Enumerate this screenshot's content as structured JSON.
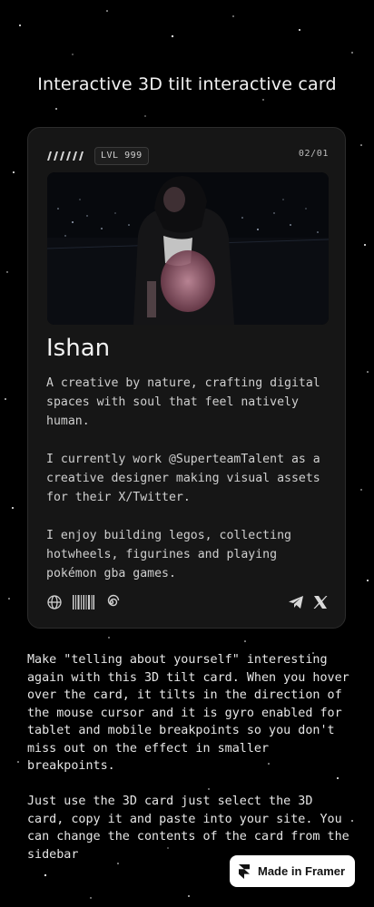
{
  "page": {
    "title": "Interactive 3D tilt interactive card",
    "background": "#000000"
  },
  "card": {
    "level_label": "LVL 999",
    "counter": "02/01",
    "photo_icon": "photo-of-person",
    "name": "Ishan",
    "bio": [
      "A creative by nature, crafting digital spaces with soul that feel natively human.",
      "I currently work @SuperteamTalent as a creative designer making visual assets for their X/Twitter.",
      "I enjoy building legos, collecting hotwheels, figurines and playing pokémon gba games."
    ],
    "footer_icons": [
      "globe-icon",
      "barcode-icon",
      "spiral-icon",
      "telegram-icon",
      "x-icon"
    ]
  },
  "description": [
    "Make \"telling about yourself\" interesting again with this 3D tilt card. When you hover over the card, it tilts in the direction of the mouse cursor and it is gyro enabled for tablet and mobile breakpoints so you don't miss out on the effect in smaller breakpoints.",
    "Just use the 3D card just select the 3D card, copy it and paste into your site. You can change the contents of the card from the sidebar"
  ],
  "framer_badge": {
    "label": "Made in Framer",
    "icon": "framer-logo-icon"
  },
  "colors": {
    "card": "#161616",
    "card_border": "#2c2c2c",
    "text": "#e8e8e8",
    "badge": "#ffffff"
  }
}
